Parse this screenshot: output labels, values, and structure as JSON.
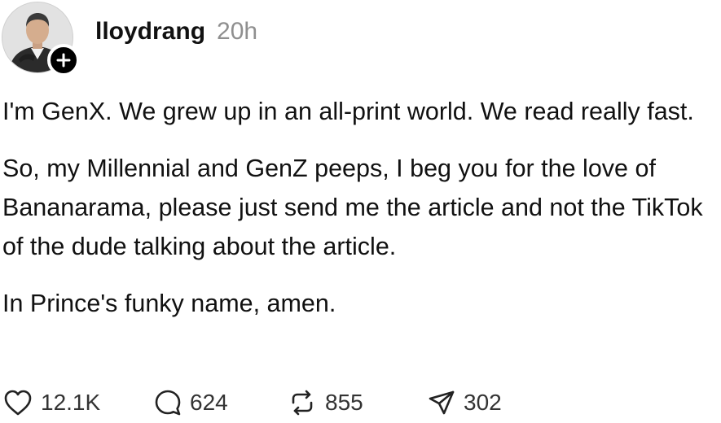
{
  "post": {
    "username": "lloydrang",
    "timestamp": "20h",
    "follow_symbol": "+",
    "paragraphs": [
      "I'm GenX. We grew up in an all-print world. We read really fast.",
      "So, my Millennial and GenZ peeps, I beg you for the love of Bananarama, please just send me the article and not the TikTok of the dude talking about the article.",
      "In Prince's funky name, amen."
    ]
  },
  "actions": {
    "likes": "12.1K",
    "replies": "624",
    "reposts": "855",
    "shares": "302"
  },
  "icons": {
    "like": "heart-icon",
    "reply": "speech-bubble-icon",
    "repost": "repost-arrows-icon",
    "share": "paper-plane-icon",
    "follow": "plus-icon"
  },
  "colors": {
    "text": "#111111",
    "muted": "#8f8f8f",
    "counts": "#333333",
    "badge": "#000000",
    "background": "#ffffff"
  }
}
